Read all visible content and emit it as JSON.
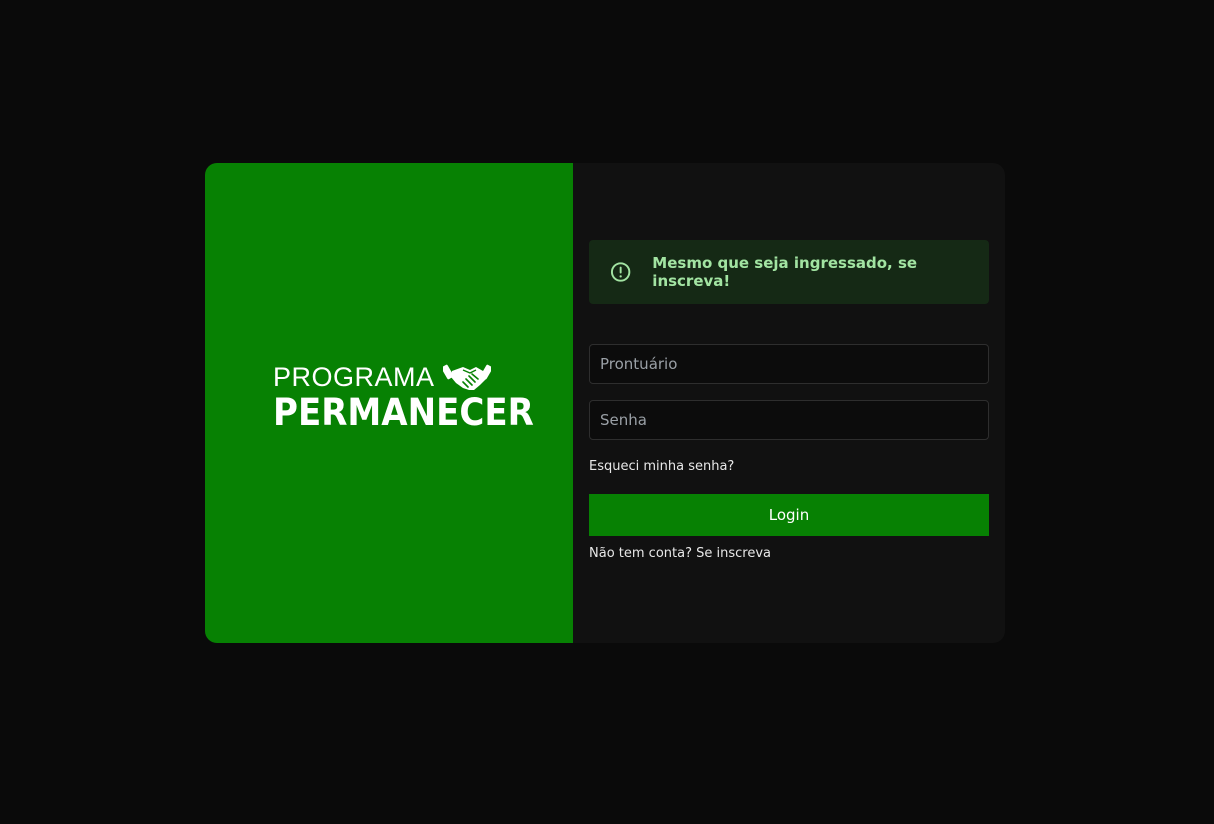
{
  "brand": {
    "line1": "PROGRAMA",
    "line2": "PERMANECER",
    "icon": "handshake-icon",
    "color": "#078103"
  },
  "alert": {
    "icon": "exclamation-circle-icon",
    "message": "Mesmo que seja ingressado, se inscreva!",
    "text_color": "#a2e4a2",
    "background": "#152915"
  },
  "form": {
    "username": {
      "placeholder": "Prontuário",
      "value": ""
    },
    "password": {
      "placeholder": "Senha",
      "value": ""
    },
    "forgot_label": "Esqueci minha senha?",
    "login_label": "Login",
    "signup_label": "Não tem conta? Se inscreva"
  },
  "colors": {
    "page_bg": "#0a0a0a",
    "card_bg": "#111111",
    "accent": "#078103"
  }
}
